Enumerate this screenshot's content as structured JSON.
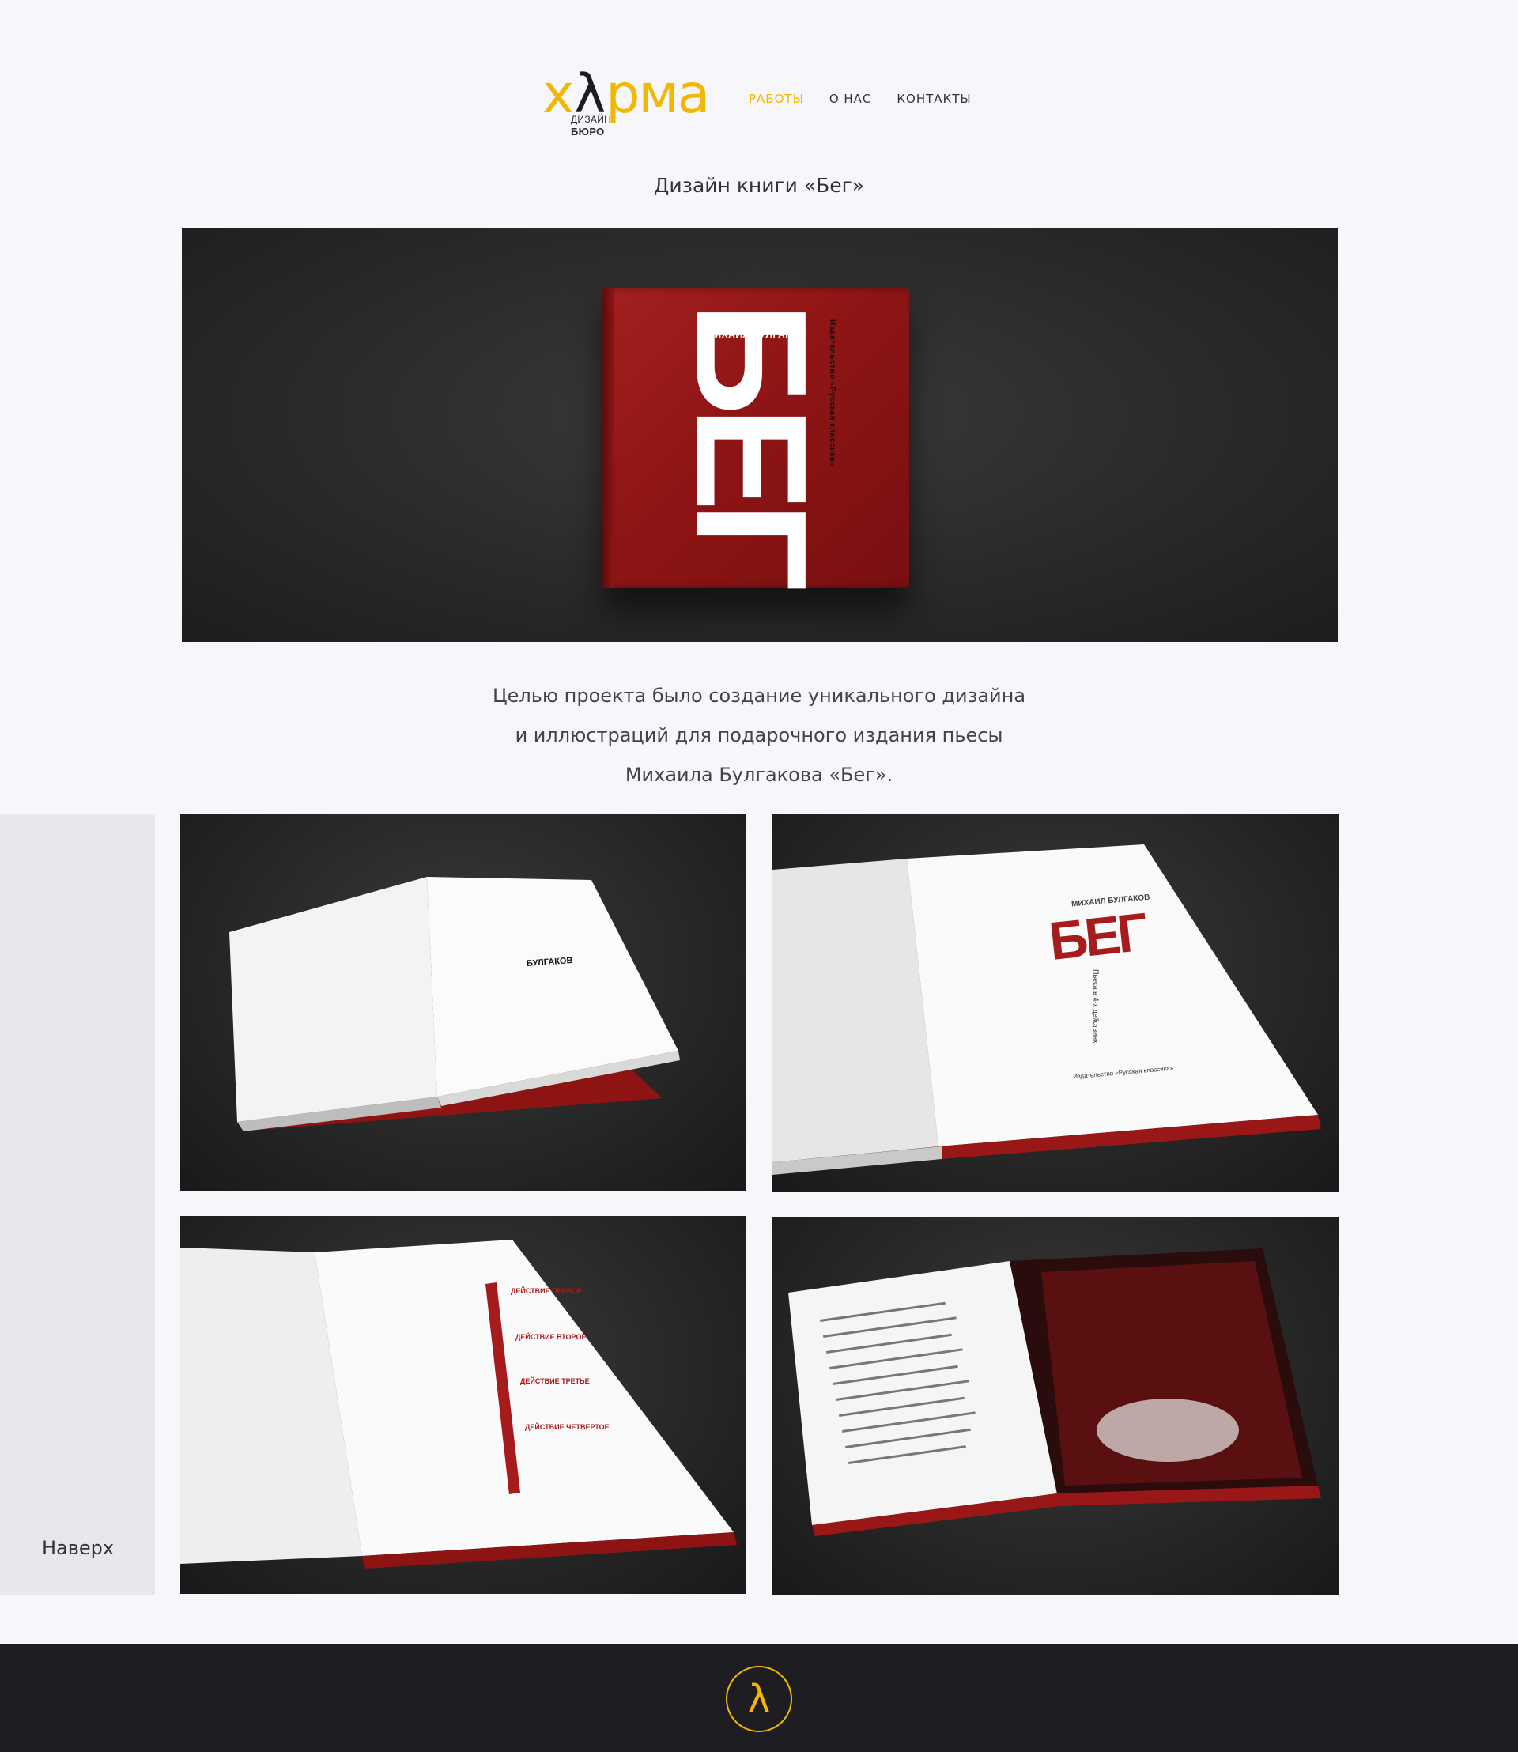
{
  "brand": {
    "logo_text_left": "х",
    "logo_lambda": "λ",
    "logo_text_right": "рма",
    "logo_sub_line1": "дизайн",
    "logo_sub_line2": "бюро",
    "accent_color": "#f2b705"
  },
  "nav": {
    "items": [
      {
        "label": "РАБОТЫ",
        "active": true
      },
      {
        "label": "О НАС",
        "active": false
      },
      {
        "label": "КОНТАКТЫ",
        "active": false
      }
    ]
  },
  "page": {
    "title": "Дизайн книги «Бег»",
    "description_lines": [
      "Целью проекта было создание уникального дизайна",
      "и иллюстраций для подарочного издания пьесы",
      "Михаила Булгакова  «Бег»."
    ]
  },
  "hero": {
    "author": "МИХАИЛ БУЛГАКОВ",
    "publisher": "Издательство «Русская классика»",
    "title": "БЕГ"
  },
  "gallery": {
    "g1_text": "БУЛГАКОВ",
    "g2_author": "МИХАИЛ БУЛГАКОВ",
    "g2_title": "БЕГ",
    "g2_subtitle": "Пьеса в 4-х действиях",
    "g2_publisher": "Издательство «Русская классика»",
    "g3_sections": [
      "ДЕЙСТВИЕ ПЕРВОЕ",
      "ДЕЙСТВИЕ ВТОРОЕ",
      "ДЕЙСТВИЕ ТРЕТЬЕ",
      "ДЕЙСТВИЕ ЧЕТВЕРТОЕ"
    ]
  },
  "sidebar": {
    "to_top_label": "Наверх"
  },
  "footer": {
    "logo_symbol": "λ"
  }
}
